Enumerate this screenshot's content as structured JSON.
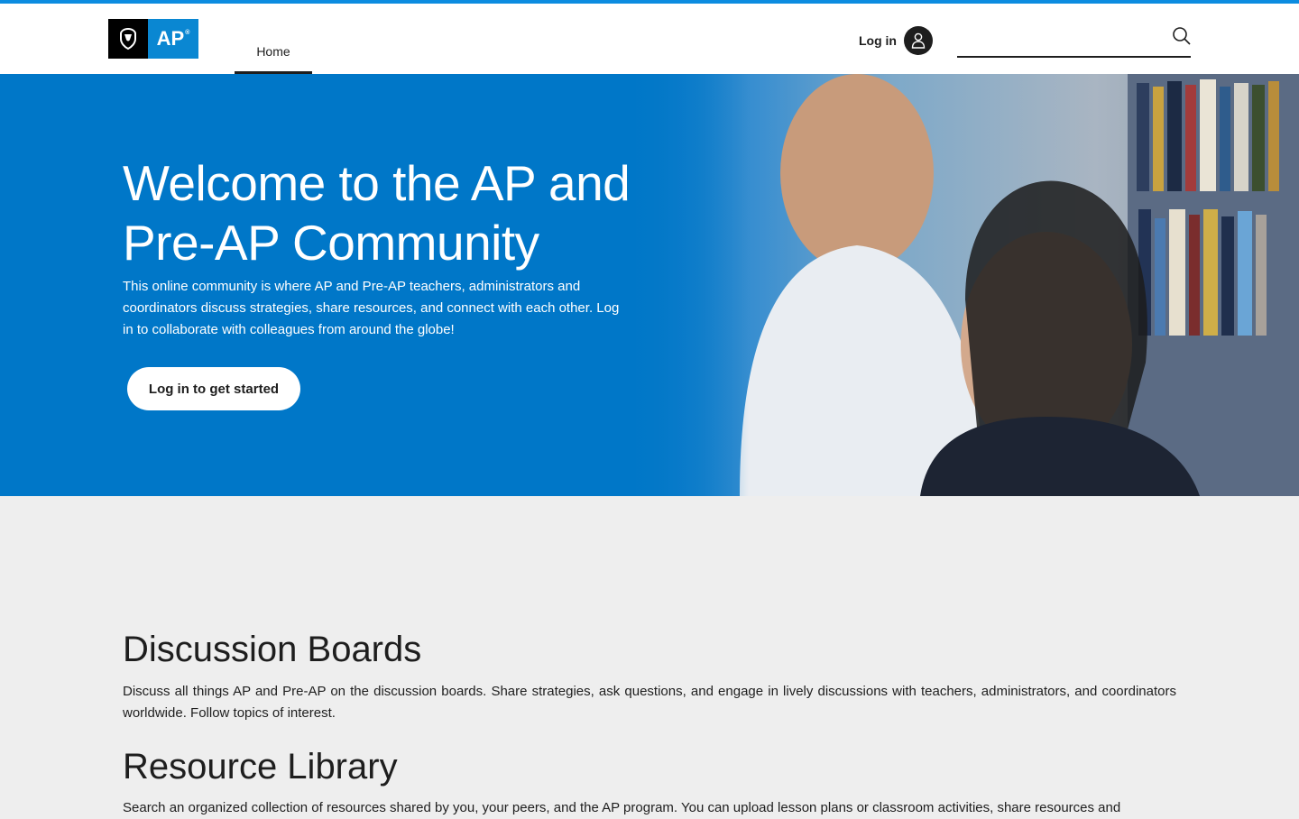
{
  "header": {
    "logo_text": "AP",
    "nav": {
      "home_label": "Home"
    },
    "login_label": "Log in",
    "search": {
      "placeholder": ""
    }
  },
  "hero": {
    "title": "Welcome to the AP and Pre-AP Community",
    "description": "This online community is where AP and Pre-AP teachers, administrators and coordinators discuss strategies, share resources, and connect with each other. Log in to collaborate with colleagues from around the globe!",
    "cta_label": "Log in to get started"
  },
  "sections": [
    {
      "title": "Discussion Boards",
      "text": "Discuss all things AP and Pre-AP on the discussion boards. Share strategies, ask questions, and engage in lively discussions with teachers, administrators, and coordinators worldwide. Follow topics of interest."
    },
    {
      "title": "Resource Library",
      "text": "Search an organized collection of resources shared by you, your peers, and the AP program. You can upload lesson plans or classroom activities, share resources and"
    }
  ],
  "colors": {
    "accent": "#0c8ce0",
    "hero_background": "#0077c8",
    "page_background": "#eeeeee"
  },
  "icons": {
    "logo": "acorn-shield-icon",
    "login": "user-icon",
    "search": "search-icon"
  }
}
